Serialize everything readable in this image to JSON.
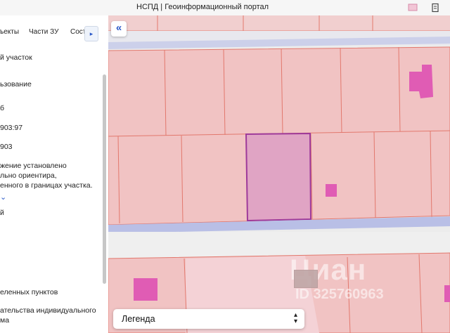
{
  "window": {
    "title": "НСПД | Геоинформационный портал"
  },
  "tabs": [
    {
      "label": "ъекты"
    },
    {
      "label": "Части ЗУ"
    },
    {
      "label": "Соста"
    }
  ],
  "panel": {
    "lines": [
      "й участок",
      "ьзование",
      "б",
      "903:97",
      "903",
      "жение установлено",
      "льно ориентира,",
      "енного в границах участка.",
      "й",
      "еленных пунктов",
      "ательства индивидуального",
      "ма"
    ]
  },
  "map": {
    "legend_label": "Легенда",
    "watermark_text": "Циан",
    "watermark_id": "ID 325760963"
  },
  "colors": {
    "parcel_fill": "#f1c3c3",
    "parcel_border": "#e2786d",
    "selected_fill": "#e0a4c4",
    "selected_border": "#9e3a9a",
    "building": "#e05cb4",
    "road": "#c5c9e6",
    "accent": "#2a59c8"
  },
  "icons": [
    "back-arrows-icon",
    "chevron-right-icon",
    "chevron-down-icon",
    "sort-arrows-icon",
    "bookmark-icon",
    "document-icon"
  ]
}
